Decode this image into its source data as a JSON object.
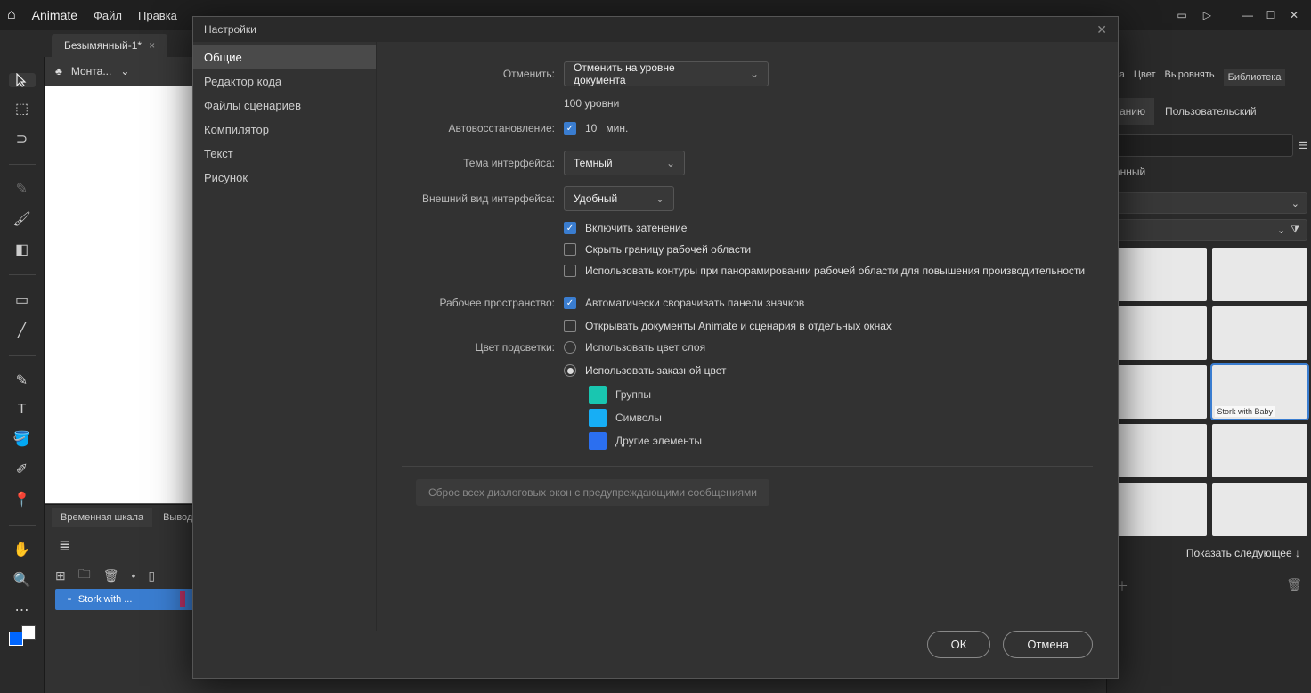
{
  "titlebar": {
    "app": "Animate",
    "menus": [
      "Файл",
      "Правка"
    ]
  },
  "doc_tab": {
    "name": "Безымянный-1*"
  },
  "stage_header": {
    "label": "Монта..."
  },
  "timeline": {
    "tabs": [
      "Временная шкала",
      "Вывод"
    ],
    "layer": "Stork with ..."
  },
  "right": {
    "panel_tabs": [
      "ва",
      "Цвет",
      "Выровнять",
      "Библиотека"
    ],
    "wsp_tabs": [
      "анию",
      "Пользовательский"
    ],
    "section": "анный",
    "selected_thumb": "Stork with Baby",
    "show_next": "Показать следующее ↓"
  },
  "dialog": {
    "title": "Настройки",
    "side": [
      "Общие",
      "Редактор кода",
      "Файлы сценариев",
      "Компилятор",
      "Текст",
      "Рисунок"
    ],
    "labels": {
      "undo": "Отменить:",
      "undo_value": "Отменить на уровне документа",
      "levels_num": "100",
      "levels_unit": "уровни",
      "autorecover": "Автовосстановление:",
      "autorecover_num": "10",
      "autorecover_unit": "мин.",
      "theme": "Тема интерфейса:",
      "theme_value": "Темный",
      "uistyle": "Внешний вид интерфейса:",
      "uistyle_value": "Удобный",
      "shade": "Включить затенение",
      "hide_border": "Скрыть границу рабочей области",
      "use_outlines": "Использовать контуры при панорамировании рабочей области для повышения производительности",
      "workspace": "Рабочее пространство:",
      "auto_collapse": "Автоматически сворачивать панели значков",
      "open_sep": "Открывать документы Animate и сценария в отдельных окнах",
      "highlight": "Цвет подсветки:",
      "use_layer_color": "Использовать цвет слоя",
      "use_custom_color": "Использовать заказной цвет",
      "groups": "Группы",
      "symbols": "Символы",
      "other": "Другие элементы",
      "reset": "Сброс всех диалоговых окон с предупреждающими сообщениями"
    },
    "colors": {
      "groups": "#19c6b0",
      "symbols": "#17aef5",
      "other": "#2b6ff0"
    },
    "buttons": {
      "ok": "ОК",
      "cancel": "Отмена"
    }
  }
}
